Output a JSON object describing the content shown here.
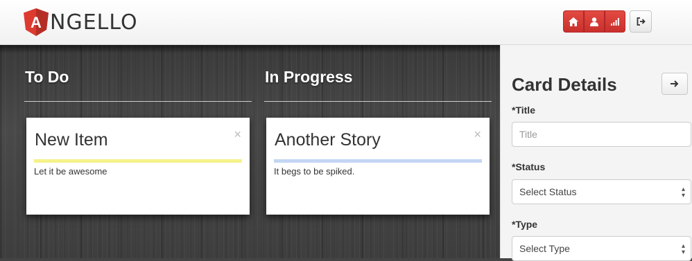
{
  "header": {
    "logo_letter": "A",
    "logo_text": "NGELLO",
    "nav_icons": [
      "home-icon",
      "user-icon",
      "signal-bars-icon"
    ],
    "logout_icon": "logout-icon",
    "accent_color": "#d9413b"
  },
  "columns": [
    {
      "title": "To Do",
      "card": {
        "title": "New Item",
        "close": "×",
        "description": "Let it be awesome",
        "bar_color": "#f5f28a"
      }
    },
    {
      "title": "In Progress",
      "card": {
        "title": "Another Story",
        "close": "×",
        "description": "It begs to be spiked.",
        "bar_color": "#c3d6f3"
      }
    }
  ],
  "details": {
    "title": "Card Details",
    "collapse_icon": "arrow-right-icon",
    "title_label": "*Title",
    "title_placeholder": "Title",
    "status_label": "*Status",
    "status_value": "Select Status",
    "type_label": "*Type",
    "type_value": "Select Type"
  }
}
